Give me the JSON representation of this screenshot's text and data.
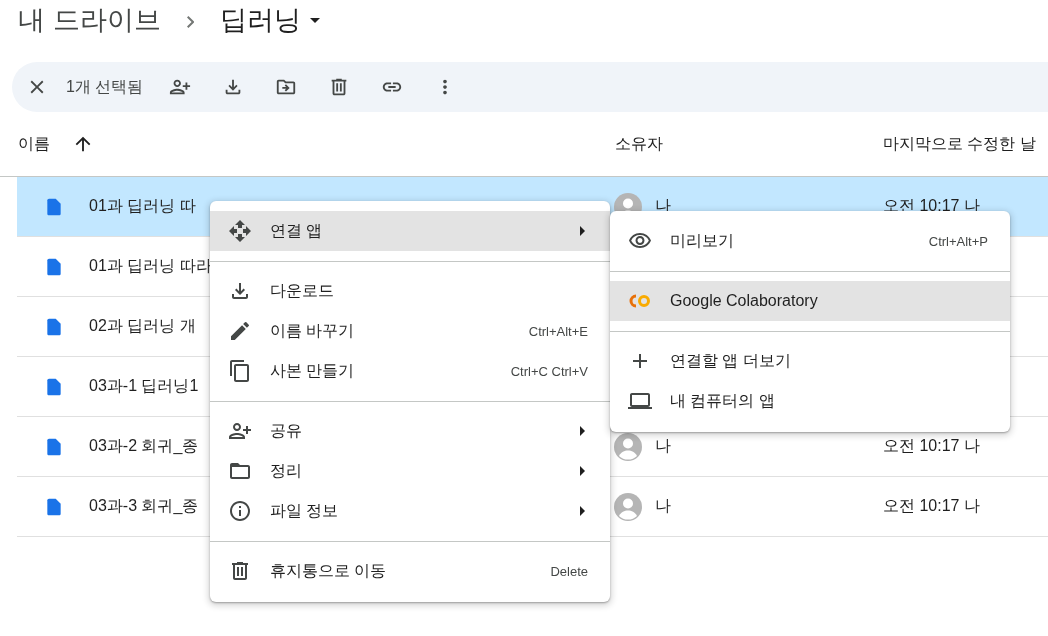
{
  "breadcrumb": {
    "parent": "내 드라이브",
    "current": "딥러닝"
  },
  "selection_bar": {
    "count_label": "1개 선택됨"
  },
  "table": {
    "columns": [
      {
        "label": "이름",
        "sorted": true
      },
      {
        "label": "소유자",
        "sorted": false
      },
      {
        "label": "마지막으로 수정한 날",
        "sorted": false
      }
    ],
    "rows": [
      {
        "name": "01과 딥러닝 따",
        "owner": "나",
        "modified": "오전 10:17 나",
        "selected": true
      },
      {
        "name": "01과 딥러닝 따라",
        "selected": false
      },
      {
        "name": "02과 딥러닝 개",
        "selected": false
      },
      {
        "name": "03과-1 딥러닝1",
        "selected": false
      },
      {
        "name": "03과-2 회귀_종",
        "owner": "나",
        "modified": "오전 10:17 나",
        "selected": false
      },
      {
        "name": "03과-3 회귀_종",
        "owner": "나",
        "modified": "오전 10:17 나",
        "selected": false
      }
    ]
  },
  "context_menu": {
    "items": [
      {
        "kind": "item",
        "label": "연결 앱",
        "submenu": true,
        "highlighted": true
      },
      {
        "kind": "divider"
      },
      {
        "kind": "item",
        "label": "다운로드",
        "submenu": false,
        "highlighted": false
      },
      {
        "kind": "item",
        "label": "이름 바꾸기",
        "shortcut": "Ctrl+Alt+E",
        "submenu": false,
        "highlighted": false
      },
      {
        "kind": "item",
        "label": "사본 만들기",
        "shortcut": "Ctrl+C Ctrl+V",
        "submenu": false,
        "highlighted": false
      },
      {
        "kind": "divider"
      },
      {
        "kind": "item",
        "label": "공유",
        "submenu": true,
        "highlighted": false
      },
      {
        "kind": "item",
        "label": "정리",
        "submenu": true,
        "highlighted": false
      },
      {
        "kind": "item",
        "label": "파일 정보",
        "submenu": true,
        "highlighted": false
      },
      {
        "kind": "divider"
      },
      {
        "kind": "item",
        "label": "휴지통으로 이동",
        "shortcut": "Delete",
        "submenu": false,
        "highlighted": false
      }
    ]
  },
  "submenu": {
    "items": [
      {
        "kind": "item",
        "label": "미리보기",
        "shortcut": "Ctrl+Alt+P",
        "submenu": false,
        "highlighted": false
      },
      {
        "kind": "divider"
      },
      {
        "kind": "item",
        "label": "Google Colaboratory",
        "submenu": false,
        "highlighted": true
      },
      {
        "kind": "divider"
      },
      {
        "kind": "item",
        "label": "연결할 앱 더보기",
        "submenu": false,
        "highlighted": false
      },
      {
        "kind": "item",
        "label": "내 컴퓨터의 앱",
        "submenu": false,
        "highlighted": false
      }
    ]
  }
}
